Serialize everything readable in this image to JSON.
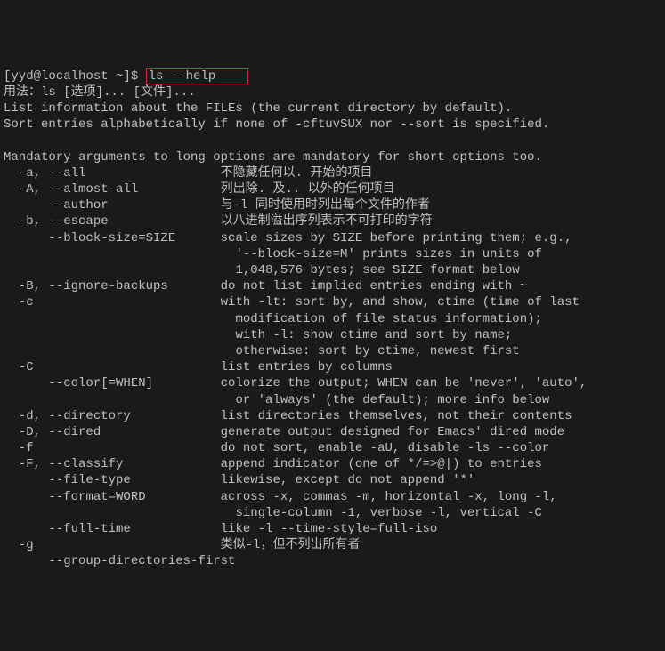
{
  "prompt": {
    "user_host": "[yyd@localhost ~]$ ",
    "command": "ls --help"
  },
  "output_lines": [
    "用法：ls [选项]... [文件]...",
    "List information about the FILEs (the current directory by default).",
    "Sort entries alphabetically if none of -cftuvSUX nor --sort is specified.",
    "",
    "Mandatory arguments to long options are mandatory for short options too.",
    "  -a, --all                  不隐藏任何以. 开始的项目",
    "  -A, --almost-all           列出除. 及.. 以外的任何项目",
    "      --author               与-l 同时使用时列出每个文件的作者",
    "  -b, --escape               以八进制溢出序列表示不可打印的字符",
    "      --block-size=SIZE      scale sizes by SIZE before printing them; e.g.,",
    "                               '--block-size=M' prints sizes in units of",
    "                               1,048,576 bytes; see SIZE format below",
    "  -B, --ignore-backups       do not list implied entries ending with ~",
    "  -c                         with -lt: sort by, and show, ctime (time of last",
    "                               modification of file status information);",
    "                               with -l: show ctime and sort by name;",
    "                               otherwise: sort by ctime, newest first",
    "  -C                         list entries by columns",
    "      --color[=WHEN]         colorize the output; WHEN can be 'never', 'auto',",
    "                               or 'always' (the default); more info below",
    "  -d, --directory            list directories themselves, not their contents",
    "  -D, --dired                generate output designed for Emacs' dired mode",
    "  -f                         do not sort, enable -aU, disable -ls --color",
    "  -F, --classify             append indicator (one of */=>@|) to entries",
    "      --file-type            likewise, except do not append '*'",
    "      --format=WORD          across -x, commas -m, horizontal -x, long -l,",
    "                               single-column -1, verbose -l, vertical -C",
    "      --full-time            like -l --time-style=full-iso",
    "  -g                         类似-l，但不列出所有者",
    "      --group-directories-first"
  ]
}
